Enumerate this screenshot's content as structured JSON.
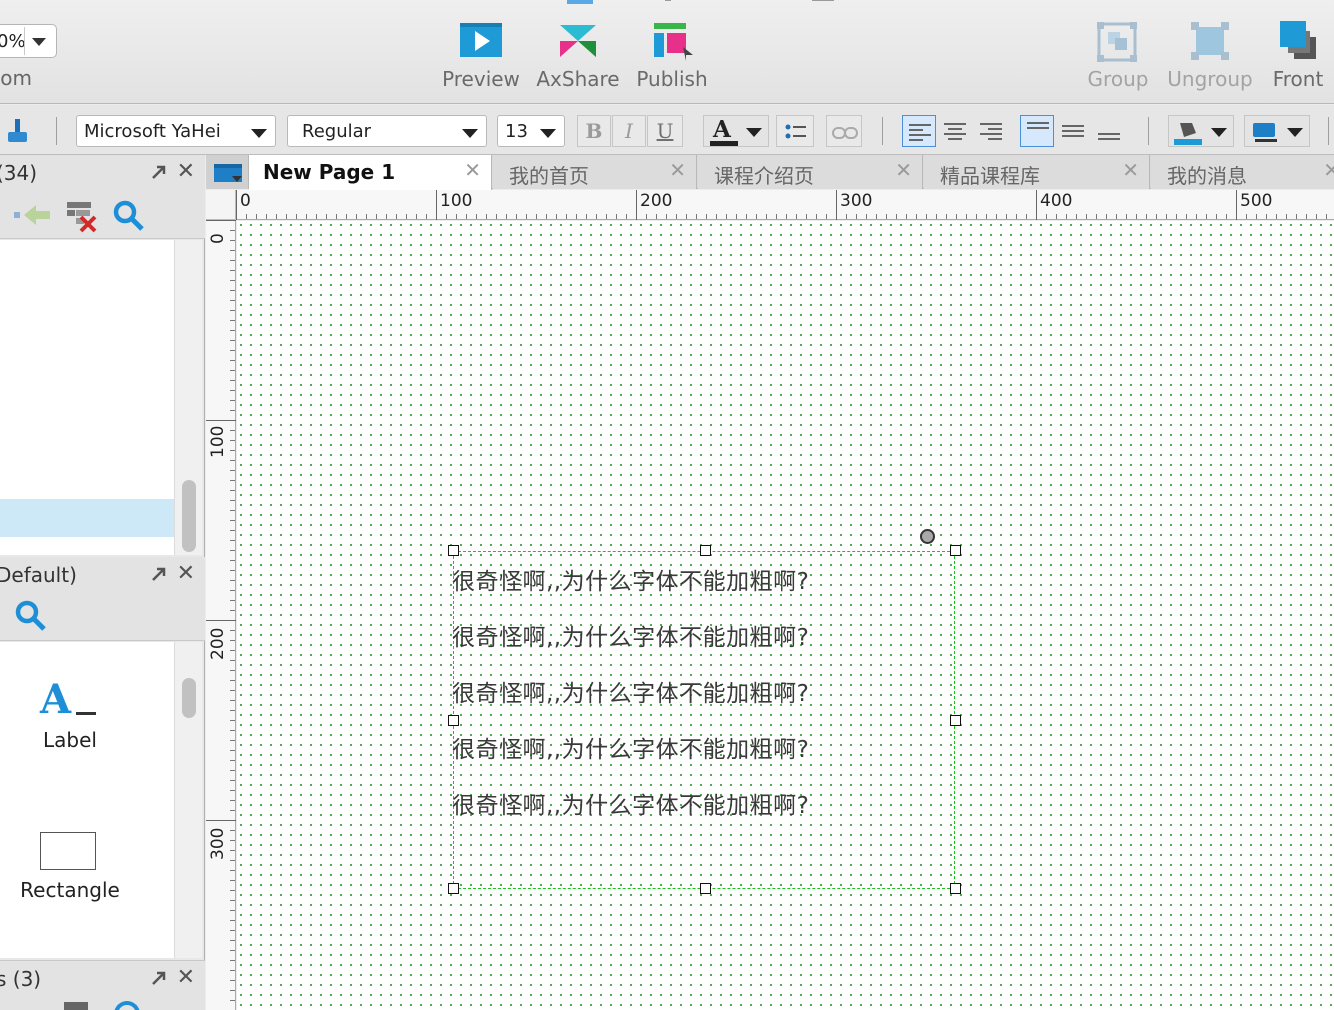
{
  "toolbar": {
    "zoom_value": "0%",
    "zoom_label": "oom",
    "buttons": {
      "preview": "Preview",
      "axshare": "AxShare",
      "publish": "Publish",
      "group": "Group",
      "ungroup": "Ungroup",
      "front": "Front"
    }
  },
  "format": {
    "font_family": "Microsoft YaHei",
    "font_style": "Regular",
    "font_size": "13",
    "bold": "B",
    "italic": "I",
    "underline": "U",
    "font_color_glyph": "A"
  },
  "panels": {
    "sitemap_title": "(34)",
    "widgets_title": "Default)",
    "masters_title": "s (3)",
    "widgets": {
      "label_name": "Label",
      "rectangle_name": "Rectangle",
      "label_glyph": "A"
    }
  },
  "tabs": [
    {
      "label": "New Page 1",
      "active": true
    },
    {
      "label": "我的首页",
      "active": false
    },
    {
      "label": "课程介绍页",
      "active": false
    },
    {
      "label": "精品课程库",
      "active": false
    },
    {
      "label": "我的消息",
      "active": false
    }
  ],
  "ruler": {
    "top_labels": [
      "0",
      "100",
      "200",
      "300",
      "400",
      "500"
    ],
    "left_labels": [
      "0",
      "100",
      "200",
      "300"
    ]
  },
  "canvas": {
    "text_lines": [
      "很奇怪啊,,为什么字体不能加粗啊?",
      "很奇怪啊,,为什么字体不能加粗啊?",
      "很奇怪啊,,为什么字体不能加粗啊?",
      "很奇怪啊,,为什么字体不能加粗啊?",
      "很奇怪啊,,为什么字体不能加粗啊?"
    ]
  },
  "colors": {
    "accent_blue": "#1e9ad6",
    "selection_green": "#19c219",
    "grid_dot": "#48a848",
    "selected_row": "#cde8f6"
  },
  "icons": {
    "preview": "preview-play-icon",
    "axshare": "axshare-logo-icon",
    "publish": "publish-icon",
    "group": "group-icon",
    "ungroup": "ungroup-icon",
    "front": "bring-to-front-icon"
  }
}
